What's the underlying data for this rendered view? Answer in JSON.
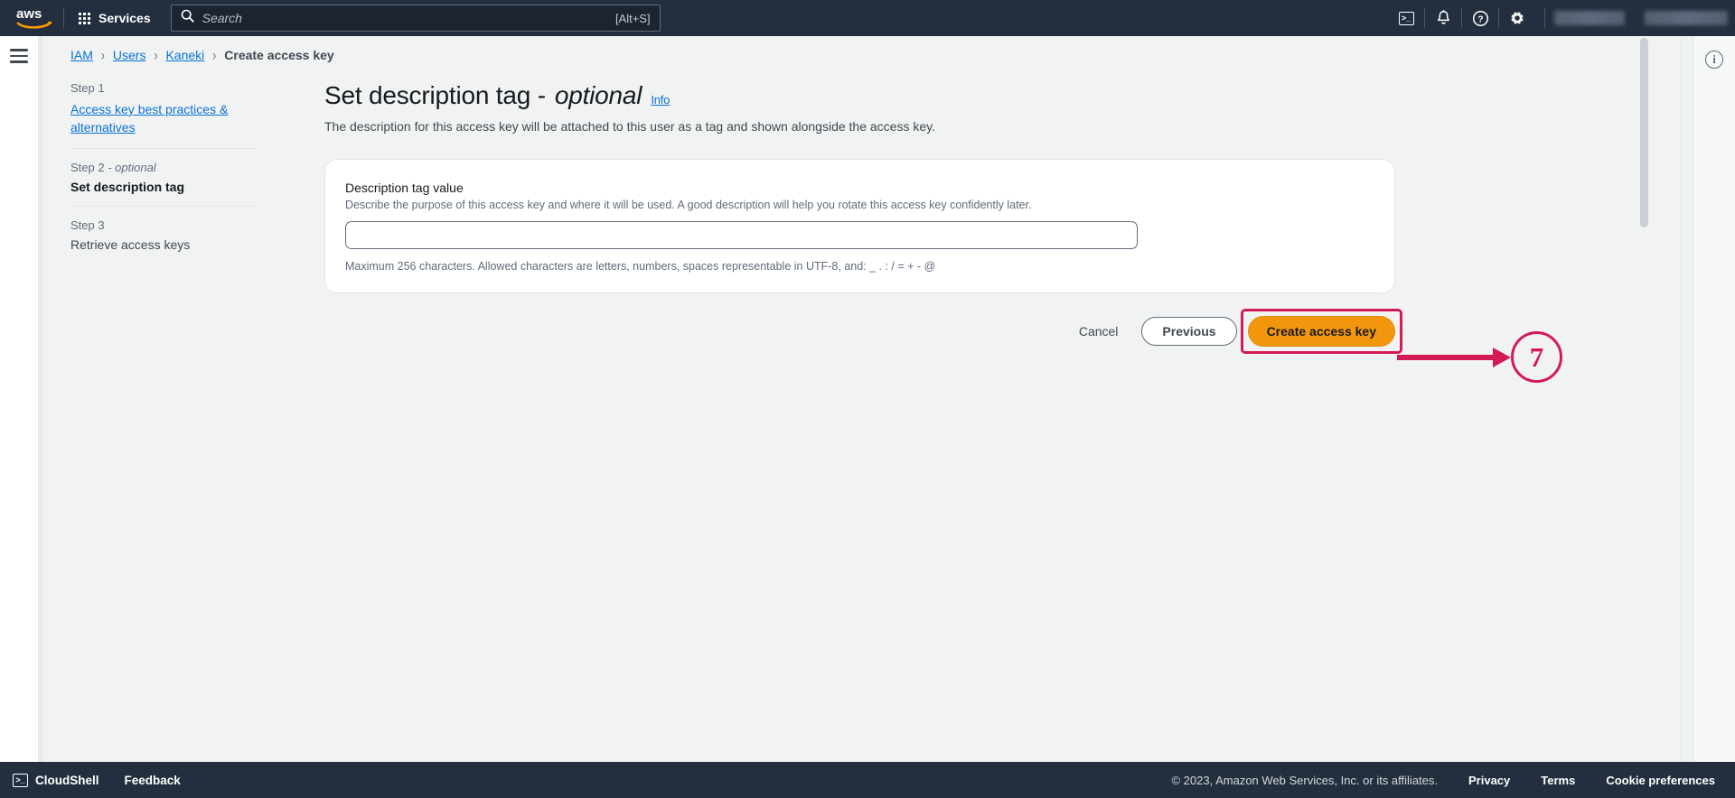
{
  "topnav": {
    "logo_alt": "aws",
    "services_label": "Services",
    "search_placeholder": "Search",
    "search_value": "",
    "search_shortcut": "[Alt+S]",
    "icons": [
      "cloudshell-icon",
      "notifications-bell-icon",
      "help-question-icon",
      "settings-gear-icon"
    ],
    "account_placeholder": "",
    "region_placeholder": ""
  },
  "breadcrumb": {
    "items": [
      {
        "label": "IAM",
        "link": true
      },
      {
        "label": "Users",
        "link": true
      },
      {
        "label": "Kaneki",
        "link": true
      },
      {
        "label": "Create access key",
        "link": false
      }
    ],
    "separator": "›"
  },
  "sidebar": {
    "steps": [
      {
        "number": "Step 1",
        "optional": "",
        "label": "Access key best practices & alternatives",
        "state": "link"
      },
      {
        "number": "Step 2",
        "optional": " - optional",
        "label": "Set description tag",
        "state": "current"
      },
      {
        "number": "Step 3",
        "optional": "",
        "label": "Retrieve access keys",
        "state": "upcoming"
      }
    ]
  },
  "main": {
    "title_text": "Set description tag - ",
    "title_optional": "optional",
    "info_label": "Info",
    "description": "The description for this access key will be attached to this user as a tag and shown alongside the access key.",
    "field": {
      "label": "Description tag value",
      "helper": "Describe the purpose of this access key and where it will be used. A good description will help you rotate this access key confidently later.",
      "value": "",
      "placeholder": "",
      "constraint": "Maximum 256 characters. Allowed characters are letters, numbers, spaces representable in UTF-8, and: _ . : / = + - @"
    },
    "actions": {
      "cancel": "Cancel",
      "previous": "Previous",
      "create": "Create access key"
    }
  },
  "annotation": {
    "step_number": "7",
    "color": "#d41a54",
    "target": "create-access-key-button"
  },
  "right_panel": {
    "info_icon": "info-circle-icon"
  },
  "footer": {
    "cloudshell": "CloudShell",
    "feedback": "Feedback",
    "copyright": "© 2023, Amazon Web Services, Inc. or its affiliates.",
    "links": [
      "Privacy",
      "Terms",
      "Cookie preferences"
    ]
  },
  "colors": {
    "nav_background": "#232f3e",
    "page_background": "#f1f3f3",
    "link_blue": "#0972d3",
    "primary_orange": "#f2970d",
    "annotation_crimson": "#d41a54"
  }
}
